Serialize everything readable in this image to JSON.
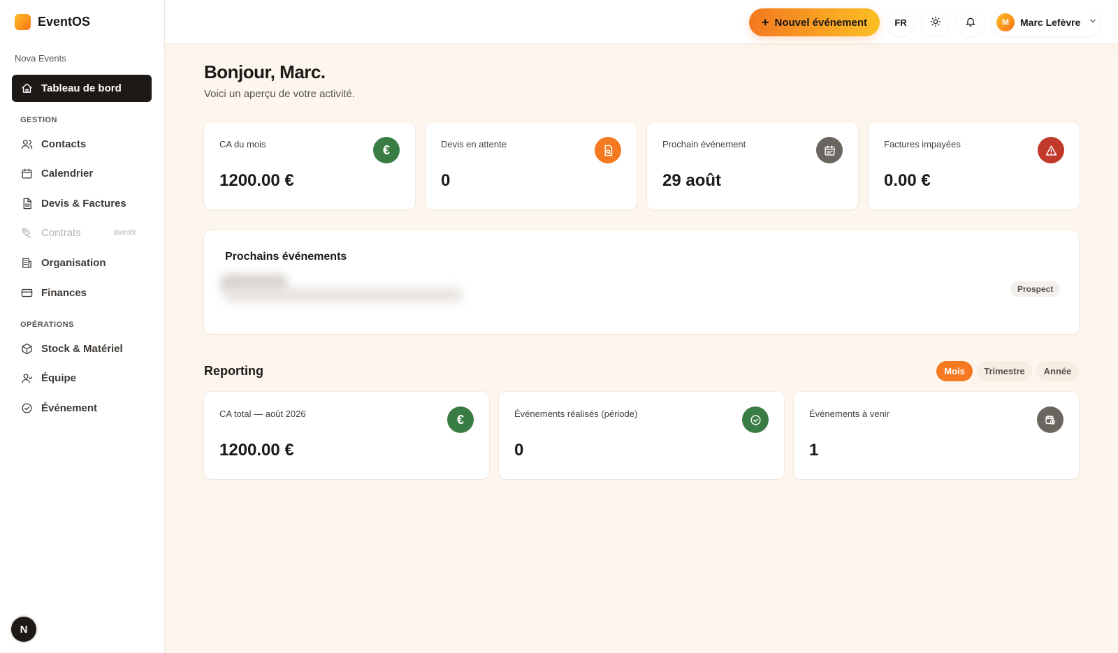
{
  "brand": {
    "name": "EventOS"
  },
  "org": {
    "name": "Nova Events"
  },
  "sidebar": {
    "active": {
      "label": "Tableau de bord",
      "icon": "home-icon"
    },
    "sections": [
      {
        "title": "GESTION"
      },
      {
        "title": "OPÉRATIONS"
      }
    ],
    "items": [
      {
        "label": "Contacts",
        "icon": "users-icon"
      },
      {
        "label": "Calendrier",
        "icon": "calendar-icon"
      },
      {
        "label": "Devis & Factures",
        "icon": "document-icon"
      },
      {
        "label": "Contrats",
        "icon": "signature-icon",
        "badge": "Bientôt",
        "disabled": true
      },
      {
        "label": "Organisation",
        "icon": "building-icon"
      },
      {
        "label": "Finances",
        "icon": "credit-card-icon"
      },
      {
        "label": "Stock & Matériel",
        "icon": "box-icon"
      },
      {
        "label": "Équipe",
        "icon": "team-icon"
      },
      {
        "label": "Événement",
        "icon": "check-circle-icon"
      }
    ],
    "bottom_avatar": "N"
  },
  "header": {
    "new_event_label": "Nouvel événement",
    "language": "FR",
    "user": {
      "initial": "M",
      "name": "Marc Lefèvre"
    }
  },
  "main": {
    "greeting": "Bonjour, Marc.",
    "subtitle": "Voici un aperçu de votre activité.",
    "stats": [
      {
        "label": "CA du mois",
        "value": "1200.00 €",
        "icon": "euro-icon",
        "color": "#3a7d44"
      },
      {
        "label": "Devis en attente",
        "value": "0",
        "icon": "quote-icon",
        "color": "#f47920"
      },
      {
        "label": "Prochain événement",
        "value": "29 août",
        "icon": "calendar-icon",
        "color": "#6b6560"
      },
      {
        "label": "Factures impayées",
        "value": "0.00 €",
        "icon": "warning-icon",
        "color": "#c0392b"
      }
    ],
    "upcoming": {
      "title": "Prochains événements",
      "badge": "Prospect"
    },
    "reporting": {
      "title": "Reporting",
      "periods": [
        "Mois",
        "Trimestre",
        "Année"
      ],
      "active_period": "Mois",
      "cards": [
        {
          "label": "CA total — août 2026",
          "value": "1200.00 €",
          "icon": "euro-icon",
          "color": "#3a7d44"
        },
        {
          "label": "Événements réalisés (période)",
          "value": "0",
          "icon": "check-circle-icon",
          "color": "#3a7d44"
        },
        {
          "label": "Événements à venir",
          "value": "1",
          "icon": "calendar-clock-icon",
          "color": "#6b6560"
        }
      ]
    }
  },
  "colors": {
    "accent": "#f47920",
    "dark": "#1c1917",
    "background": "#fdf6ee"
  }
}
